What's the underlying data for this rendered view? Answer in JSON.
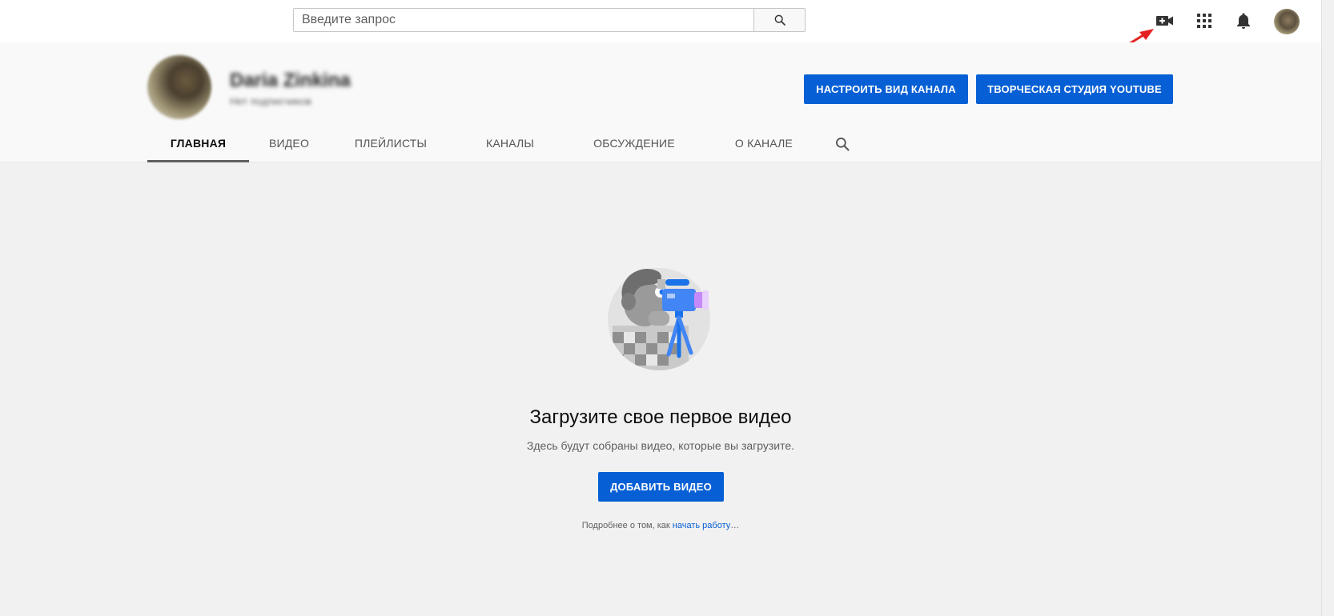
{
  "masthead": {
    "search_placeholder": "Введите запрос",
    "icons": [
      "search-icon",
      "video-camera-add-icon",
      "apps-grid-icon",
      "bell-icon",
      "account-avatar"
    ]
  },
  "channel": {
    "name": "Daria Zinkina",
    "subscribers": "Нет подписчиков",
    "customize_button": "НАСТРОИТЬ ВИД КАНАЛА",
    "studio_button": "ТВОРЧЕСКАЯ СТУДИЯ YOUTUBE"
  },
  "tabs": [
    {
      "label": "ГЛАВНАЯ",
      "active": true
    },
    {
      "label": "ВИДЕО",
      "active": false
    },
    {
      "label": "ПЛЕЙЛИСТЫ",
      "active": false
    },
    {
      "label": "КАНАЛЫ",
      "active": false
    },
    {
      "label": "ОБСУЖДЕНИЕ",
      "active": false
    },
    {
      "label": "О КАНАЛЕ",
      "active": false
    }
  ],
  "empty_state": {
    "title": "Загрузите свое первое видео",
    "subtitle": "Здесь будут собраны видео, которые вы загрузите.",
    "add_button": "ДОБАВИТЬ ВИДЕО",
    "help_prefix": "Подробнее о том, как ",
    "help_link": "начать работу",
    "help_suffix": "…"
  },
  "colors": {
    "accent_blue": "#065fd4",
    "annotation_red": "#e52222",
    "page_bg": "#f1f1f1",
    "header_bg": "#f9f9f9"
  }
}
